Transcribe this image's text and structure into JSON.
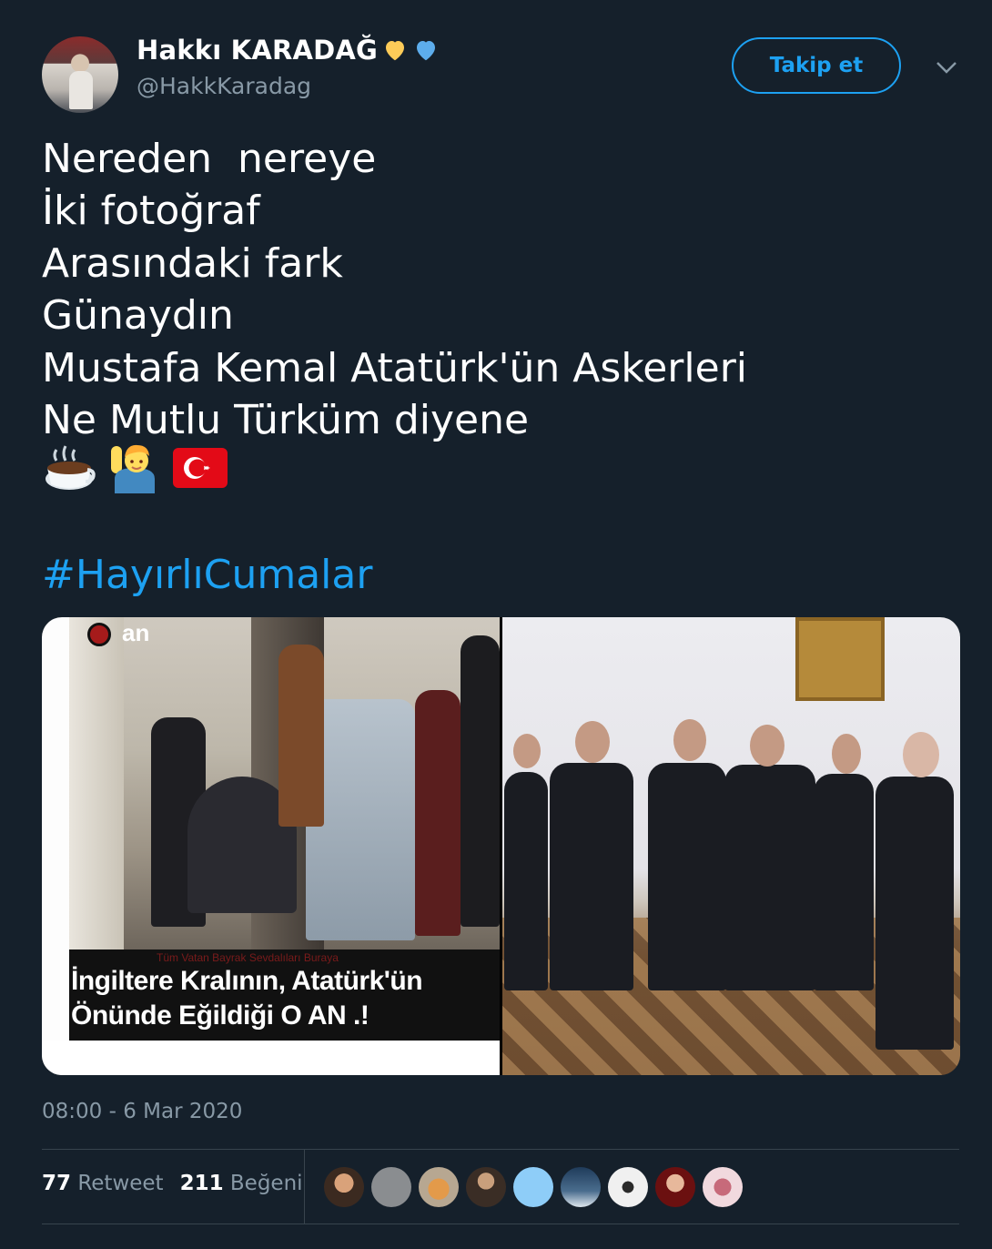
{
  "author": {
    "name": "Hakkı KARADAĞ",
    "handle": "@HakkKaradag",
    "badges": [
      "yellow-heart-icon",
      "blue-heart-icon"
    ]
  },
  "follow_label": "Takip et",
  "tweet": {
    "lines": [
      "Nereden  nereye",
      "İki fotoğraf",
      "Arasındaki fark",
      "Günaydın",
      "Mustafa Kemal Atatürk'ün Askerleri",
      "Ne Mutlu Türküm diyene"
    ],
    "emojis": [
      "hot-beverage-emoji",
      "man-raising-hand-emoji",
      "turkey-flag-emoji"
    ],
    "hashtag": "#HayırlıCumalar"
  },
  "media": {
    "left_image": {
      "logo_text": "an",
      "caption_small": "Tüm Vatan Bayrak Sevdalıları Buraya",
      "caption_line1": "İngiltere Kralının, Atatürk'ün",
      "caption_line2": "Önünde Eğildiği O AN .!"
    }
  },
  "timestamp": "08:00 - 6 Mar 2020",
  "stats": {
    "retweets_count": "77",
    "retweets_label": "Retweet",
    "likes_count": "211",
    "likes_label": "Beğeni"
  },
  "colors": {
    "background": "#15202b",
    "accent": "#1da1f2",
    "secondary_text": "#8899a6",
    "divider": "#38444d"
  }
}
